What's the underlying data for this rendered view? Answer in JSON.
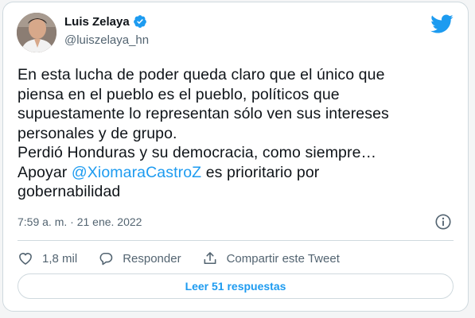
{
  "author": {
    "name": "Luis Zelaya",
    "handle": "@luiszelaya_hn",
    "verified": true
  },
  "tweet": {
    "lines": [
      "En esta lucha de poder queda claro que el único que",
      "piensa en el pueblo es el pueblo, políticos que",
      "supuestamente lo representan sólo ven sus intereses",
      "personales y de grupo.",
      "Perdió Honduras y su democracia, como siempre…"
    ],
    "line6_prefix": "Apoyar ",
    "mention": "@XiomaraCastroZ",
    "line6_suffix": " es prioritario  por",
    "line7": "gobernabilidad",
    "timestamp": "7:59 a. m. · 21 ene. 2022"
  },
  "actions": {
    "likes": "1,8 mil",
    "reply": "Responder",
    "share": "Compartir este Tweet"
  },
  "read_replies": "Leer 51 respuestas",
  "colors": {
    "accent": "#1d9bf0",
    "text": "#0f1419",
    "secondary": "#536471",
    "border": "#cfd9de"
  },
  "icons": [
    "avatar-photo",
    "verified-badge-icon",
    "twitter-bird-icon",
    "info-icon",
    "heart-icon",
    "reply-bubble-icon",
    "share-icon"
  ]
}
